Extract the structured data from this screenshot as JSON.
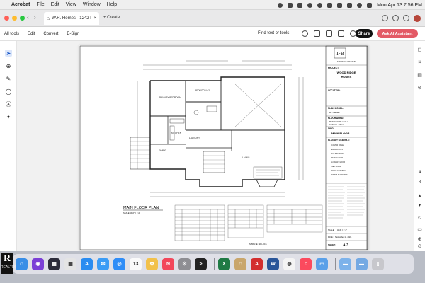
{
  "menubar": {
    "app_name": "Acrobat",
    "menus": [
      "File",
      "Edit",
      "View",
      "Window",
      "Help"
    ],
    "datetime": "Mon Apr 13  7:56 PM"
  },
  "tabbar": {
    "tab_title": "W.R. Homes - 1242 Bi-L...",
    "create_label": "+ Create"
  },
  "toolbar": {
    "items": [
      "All tools",
      "Edit",
      "Convert",
      "E-Sign"
    ],
    "find_label": "Find text or tools",
    "share_label": "Share",
    "ai_label": "Ask AI Assistant"
  },
  "right_panel": {
    "page_number": "4",
    "page_total": "8"
  },
  "drawing": {
    "plan_title": "MAIN FLOOR PLAN",
    "plan_scale": "SCALE: 3/16\" = 1'-0\"",
    "rooms": {
      "primary_bedroom": "PRIMARY BEDROOM",
      "bedroom2": "BEDROOM #2",
      "kitchen": "KITCHEN",
      "dining": "DINING",
      "living": "LIVING",
      "laundry": "LAUNDRY"
    },
    "sprinkler_note": "SPRKLTE : 18 LOCS",
    "title_block": {
      "company": "FRIDEY'S DESIGN",
      "logo": "T·B",
      "project_label": "PROJECT:",
      "project_name_1": "WOOD RIDGE",
      "project_name_2": "HOMES",
      "location_label": "LOCATION:",
      "plan_model_label": "PLAN MODEL:",
      "plan_model_value": "BI - LEVEL",
      "floor_area_label": "FLOOR AREA:",
      "floor_area_main": "MAIN FLOOR : 1242 sf",
      "floor_area_garage": "GARAGE : 242 sf",
      "dwg_label": "DWG:",
      "dwg_value": "MAIN FLOOR",
      "plan_sheet_label": "PLAN SET SCHEDULE:",
      "sheet_list": [
        "COVER PAGE",
        "ELEVATIONS",
        "FOUNDATION",
        "MAIN FLOOR",
        "LOWER FLOOR",
        "SECTIONS",
        "ROOF FRAMING",
        "DETAILS & NOTES"
      ],
      "scale_label": "SCALE:",
      "scale_value": "3/16\" = 1'-0\"",
      "date_label": "DATE:",
      "date_value": "September 11, 2024",
      "sheet_label": "SHEET:",
      "sheet_value": "A-3"
    }
  },
  "dock": {
    "icons": [
      {
        "name": "finder",
        "color": "#3a8ee6",
        "glyph": "☺"
      },
      {
        "name": "siri",
        "color": "#7b3fd6",
        "glyph": "◉"
      },
      {
        "name": "mission-control",
        "color": "#2c2c3a",
        "glyph": "▦"
      },
      {
        "name": "launchpad",
        "color": "#e4e4e4",
        "glyph": "▦"
      },
      {
        "name": "app-store",
        "color": "#2a8cf0",
        "glyph": "A"
      },
      {
        "name": "mail",
        "color": "#3b9cf5",
        "glyph": "✉"
      },
      {
        "name": "safari",
        "color": "#2f8df7",
        "glyph": "◎"
      },
      {
        "name": "calendar",
        "color": "#fafafa",
        "glyph": "13"
      },
      {
        "name": "photos",
        "color": "#f2c14a",
        "glyph": "✿"
      },
      {
        "name": "news",
        "color": "#f2475b",
        "glyph": "N"
      },
      {
        "name": "settings",
        "color": "#8e8e93",
        "glyph": "⚙"
      },
      {
        "name": "terminal",
        "color": "#222",
        "glyph": ">"
      },
      {
        "name": "excel",
        "color": "#1f7a44",
        "glyph": "X"
      },
      {
        "name": "contacts",
        "color": "#c9a66b",
        "glyph": "☺"
      },
      {
        "name": "acrobat",
        "color": "#d32f2f",
        "glyph": "A"
      },
      {
        "name": "word",
        "color": "#2a5699",
        "glyph": "W"
      },
      {
        "name": "chrome",
        "color": "#f4f4f4",
        "glyph": "◍"
      },
      {
        "name": "music",
        "color": "#fb4a5e",
        "glyph": "♫"
      },
      {
        "name": "preview",
        "color": "#5aa0e8",
        "glyph": "▭"
      },
      {
        "name": "folder",
        "color": "#7cb2ea",
        "glyph": "▬"
      },
      {
        "name": "downloads",
        "color": "#74a9e3",
        "glyph": "▬"
      },
      {
        "name": "trash",
        "color": "#c7c7cc",
        "glyph": "▯"
      }
    ]
  },
  "realtor_logo": {
    "letter": "R",
    "text": "REALTOR"
  }
}
